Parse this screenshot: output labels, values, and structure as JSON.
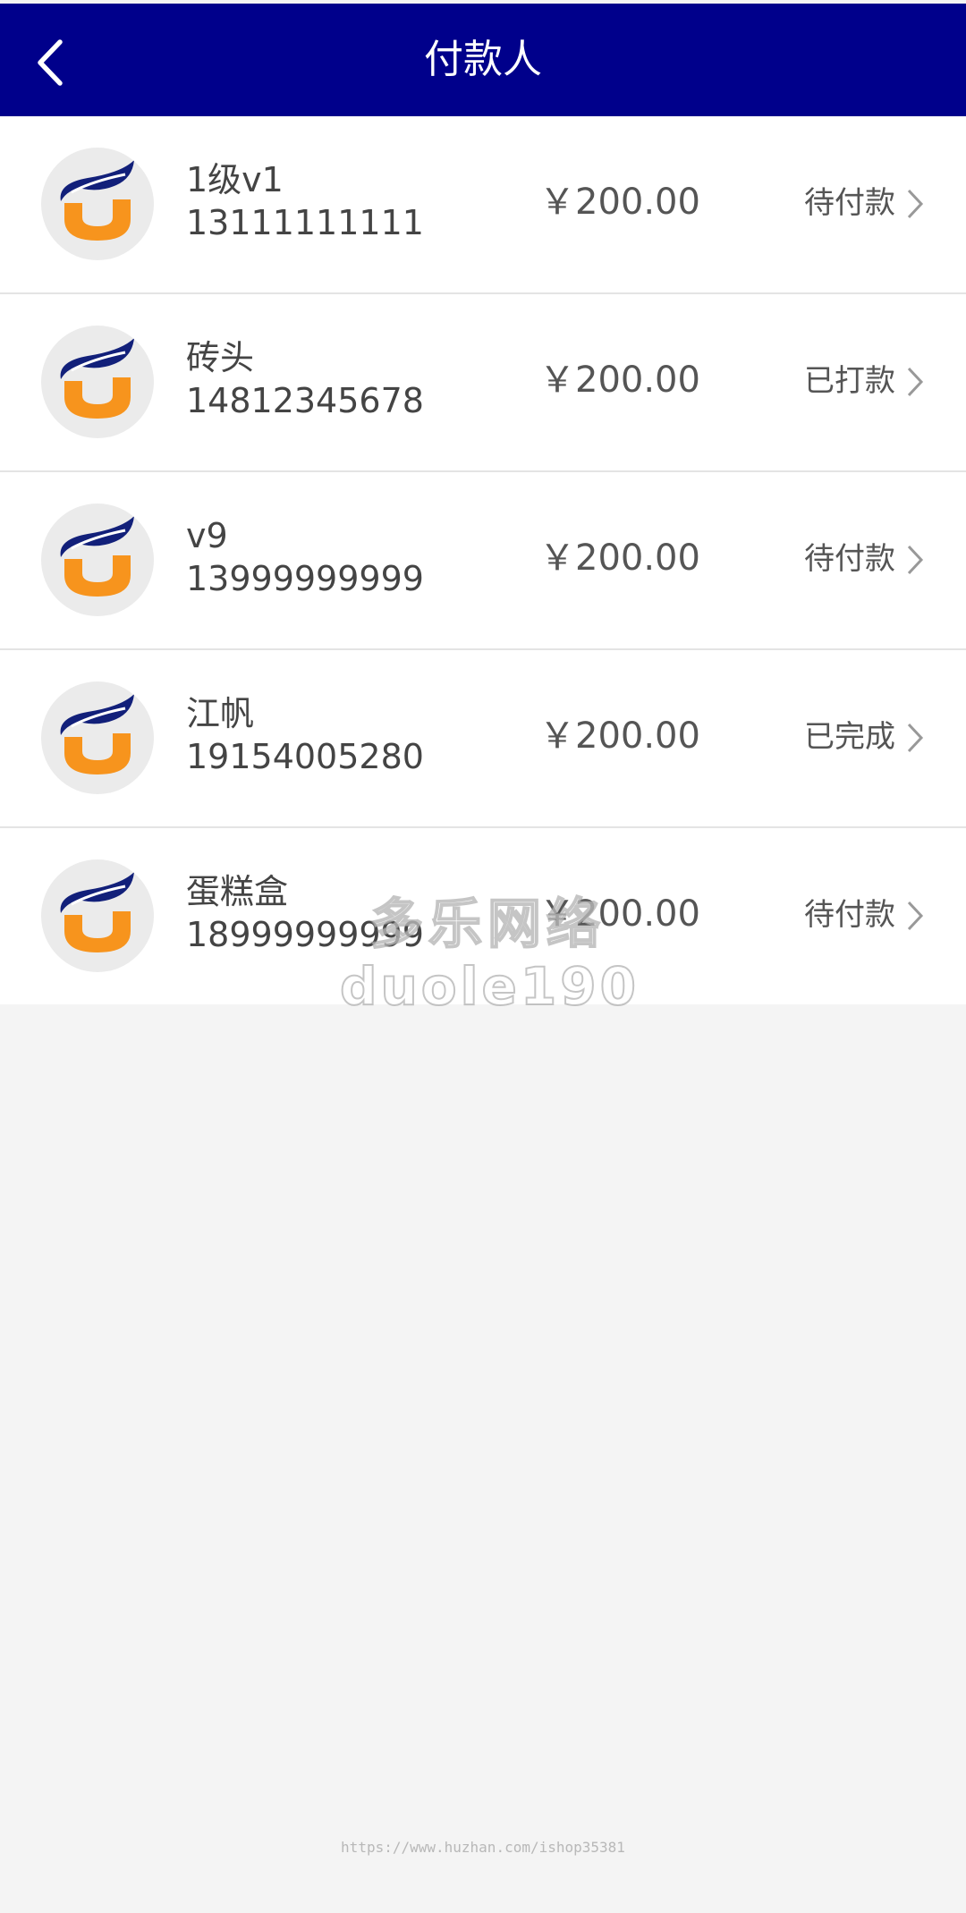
{
  "header": {
    "title": "付款人",
    "back_icon": "chevron-left-icon"
  },
  "colors": {
    "header_bg": "#00008b",
    "page_bg": "#f4f4f4",
    "logo_blue": "#12207a",
    "logo_orange": "#f7941d"
  },
  "payers": [
    {
      "name": "1级v1",
      "phone": "13111111111",
      "amount": "￥200.00",
      "status": "待付款"
    },
    {
      "name": "砖头",
      "phone": "14812345678",
      "amount": "￥200.00",
      "status": "已打款"
    },
    {
      "name": "v9",
      "phone": "13999999999",
      "amount": "￥200.00",
      "status": "待付款"
    },
    {
      "name": "江帆",
      "phone": "19154005280",
      "amount": "￥200.00",
      "status": "已完成"
    },
    {
      "name": "蛋糕盒",
      "phone": "18999999999",
      "amount": "￥200.00",
      "status": "待付款"
    }
  ],
  "watermark": {
    "line1": "多乐网络",
    "line2": "duole190"
  },
  "footer": {
    "url": "https://www.huzhan.com/ishop35381"
  }
}
